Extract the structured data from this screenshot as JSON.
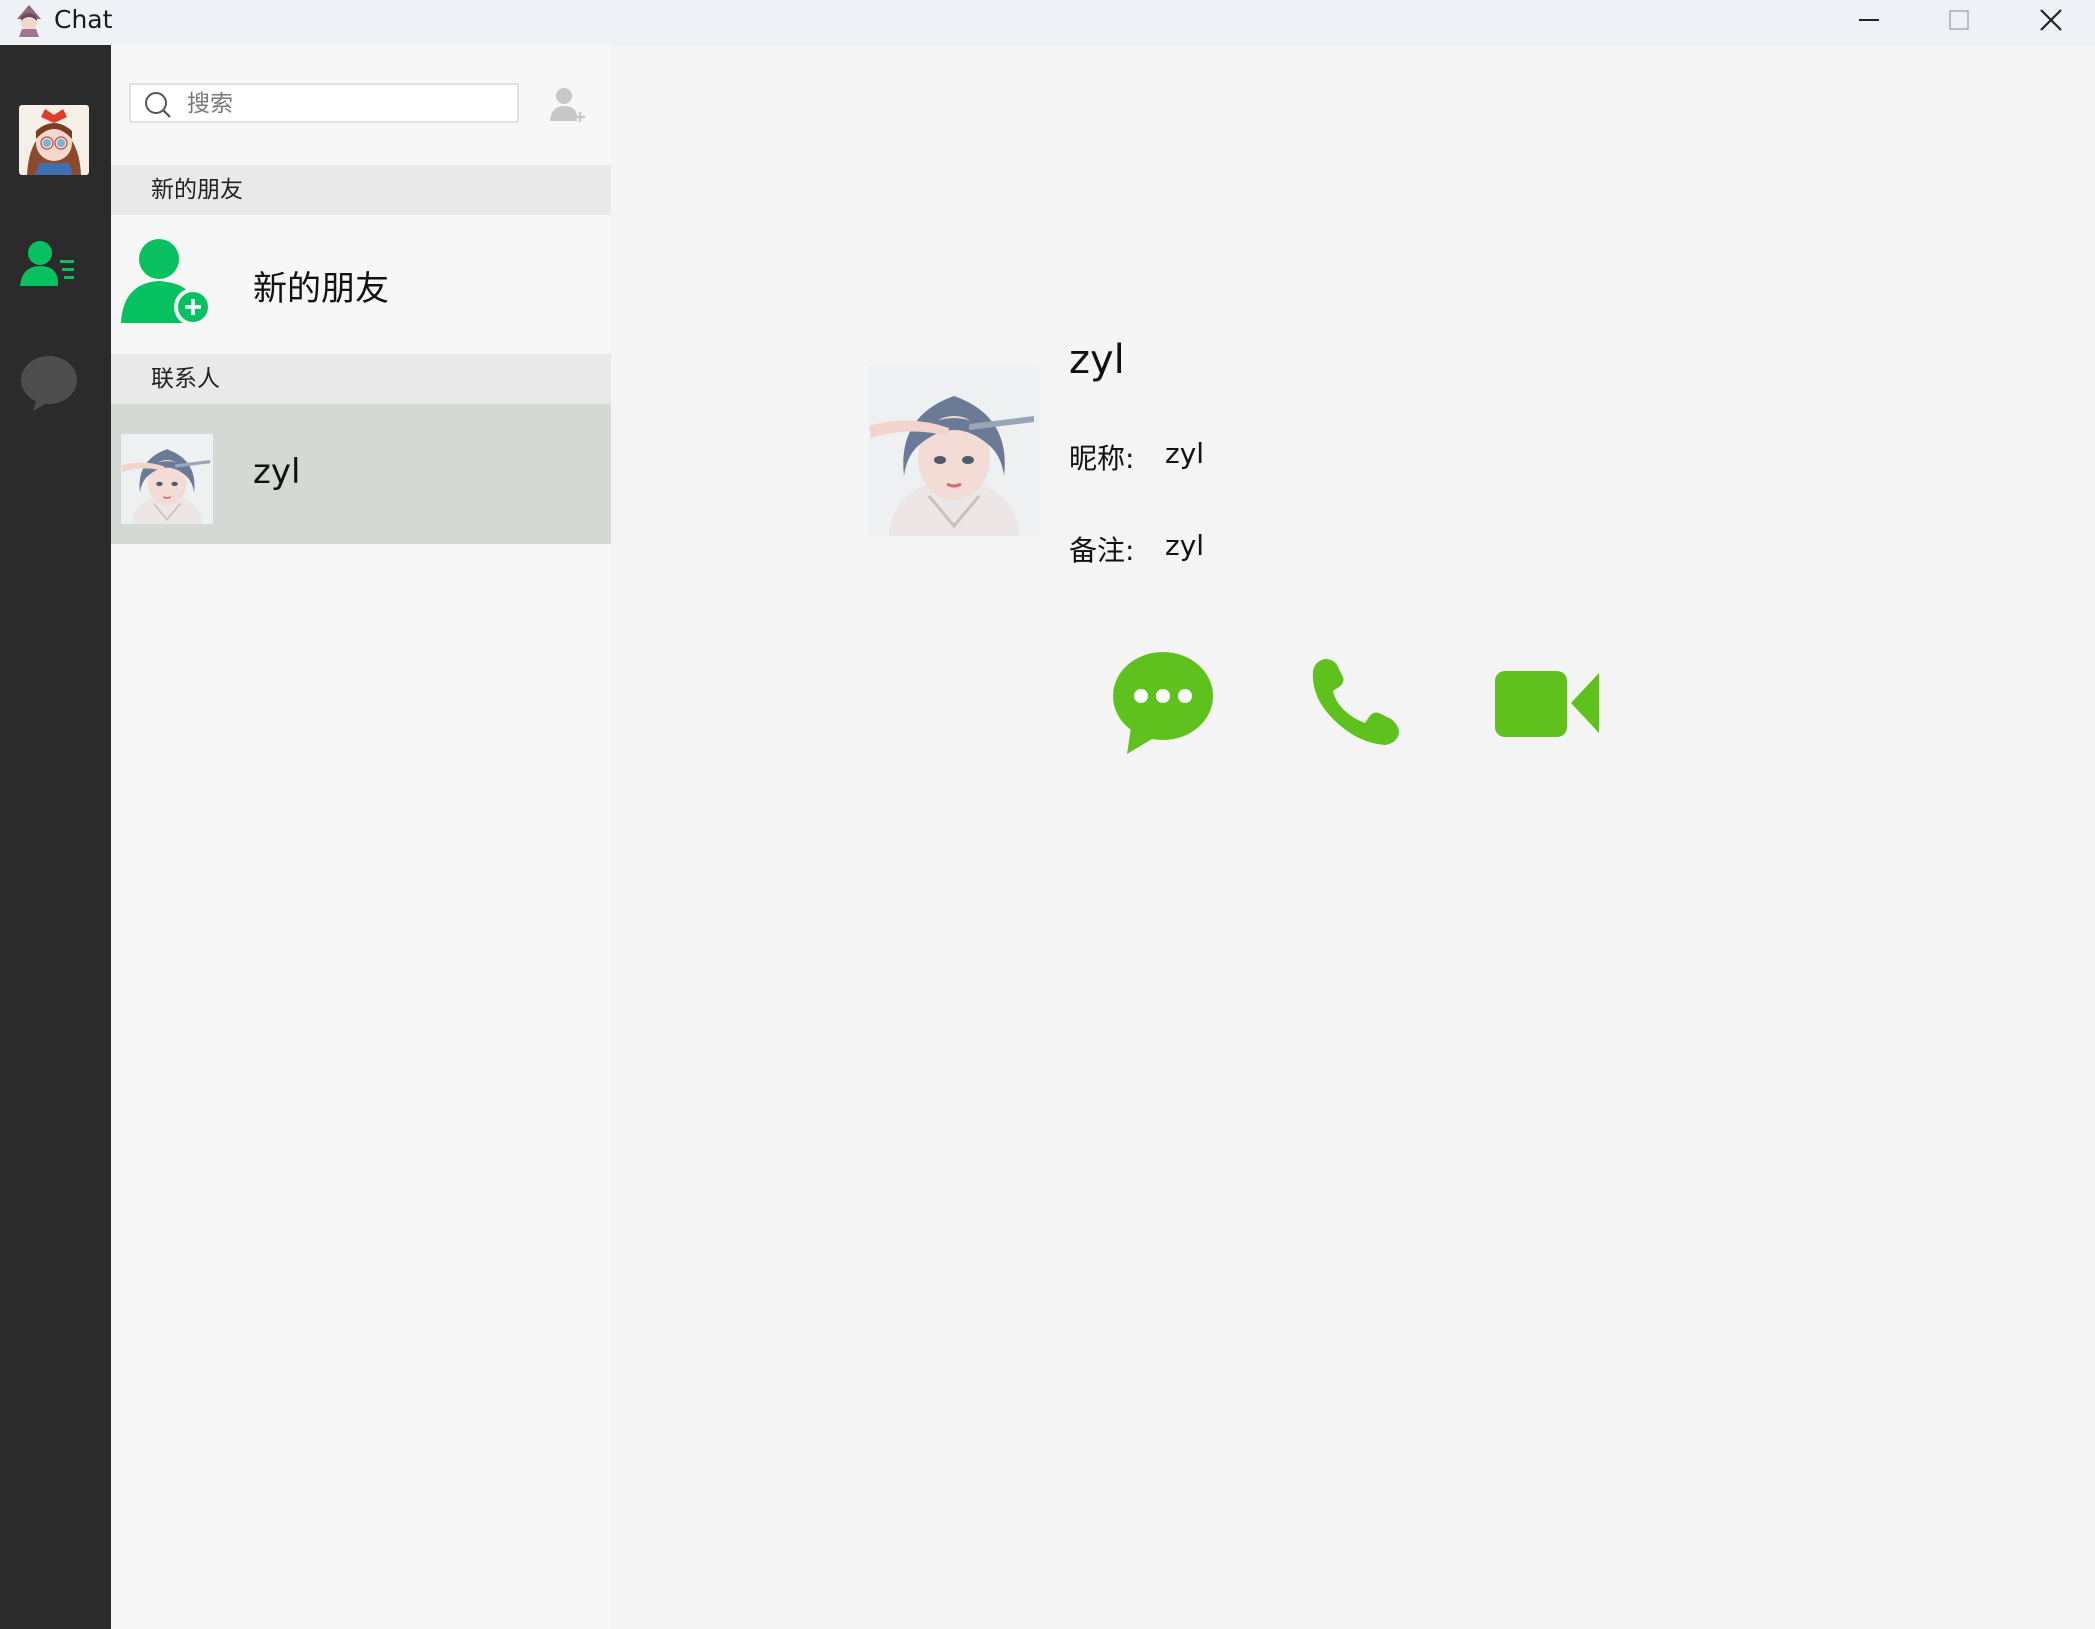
{
  "window": {
    "title": "Chat",
    "controls": [
      "minimize",
      "maximize",
      "close"
    ]
  },
  "nav": {
    "items": [
      {
        "name": "avatar",
        "icon": "user-avatar"
      },
      {
        "name": "contacts",
        "icon": "contacts-icon",
        "active": true,
        "color": "#07c160"
      },
      {
        "name": "chats",
        "icon": "chat-bubble-icon",
        "active": false,
        "color": "#4e4e4e"
      }
    ]
  },
  "contacts_panel": {
    "search": {
      "placeholder": "搜索",
      "value": ""
    },
    "sections": [
      {
        "header": "新的朋友",
        "items": [
          {
            "label": "新的朋友",
            "icon": "add-friend-icon"
          }
        ]
      },
      {
        "header": "联系人",
        "items": [
          {
            "label": "zyl",
            "selected": true
          }
        ]
      }
    ]
  },
  "detail": {
    "name": "zyl",
    "fields": [
      {
        "key": "昵称:",
        "value": "zyl"
      },
      {
        "key": "备注:",
        "value": "zyl"
      }
    ],
    "actions": [
      {
        "name": "send-message",
        "icon": "message-icon"
      },
      {
        "name": "voice-call",
        "icon": "phone-icon"
      },
      {
        "name": "video-call",
        "icon": "video-camera-icon"
      }
    ],
    "accent_color": "#5ec11e"
  },
  "colors": {
    "nav_bg": "#2b2b2b",
    "list_bg": "#f7f7f7",
    "selected_row": "#d4d9d5",
    "section_bg": "#e9e9e9",
    "detail_bg": "#f4f4f4",
    "green": "#07c160"
  }
}
